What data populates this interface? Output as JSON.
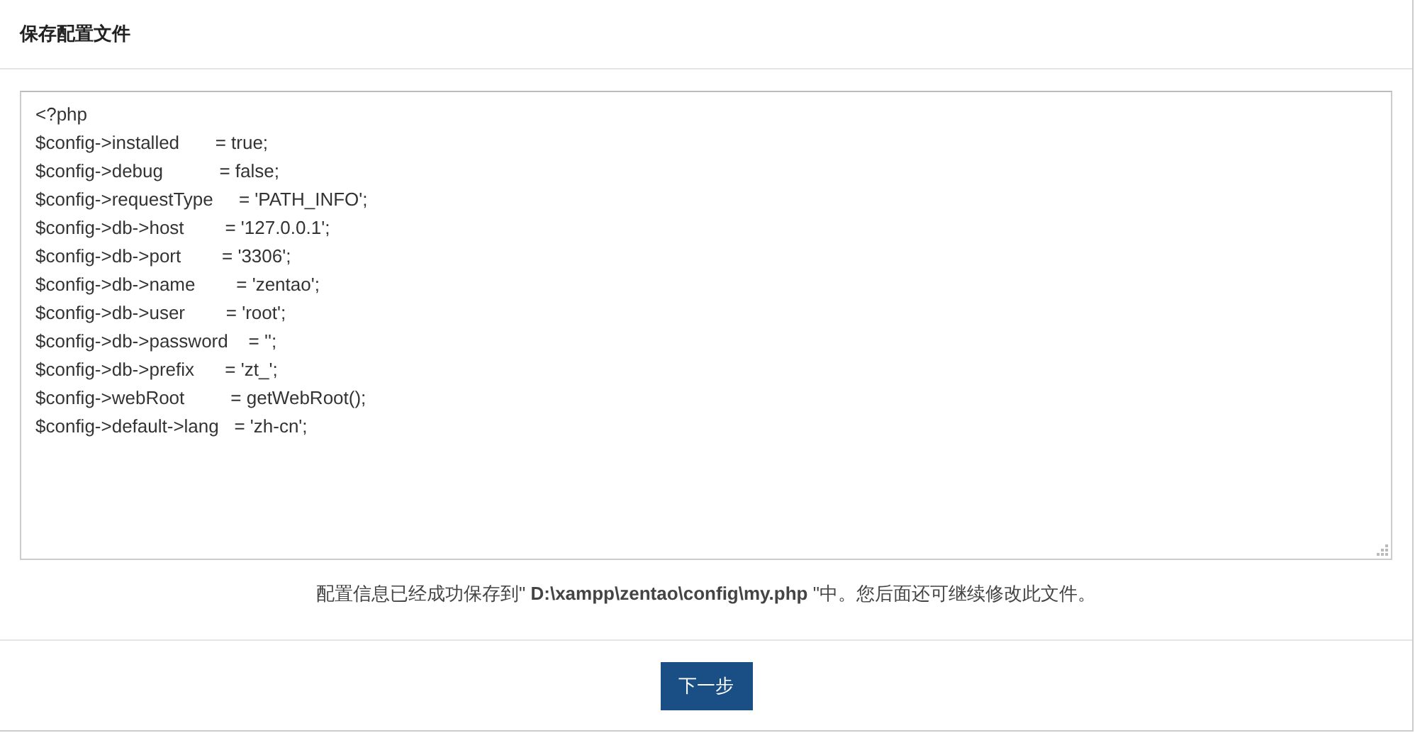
{
  "header": {
    "title": "保存配置文件"
  },
  "config_editor": {
    "lines": [
      "<?php",
      "$config->installed       = true;",
      "$config->debug           = false;",
      "$config->requestType     = 'PATH_INFO';",
      "$config->db->host        = '127.0.0.1';",
      "$config->db->port        = '3306';",
      "$config->db->name        = 'zentao';",
      "$config->db->user        = 'root';",
      "$config->db->password    = '';",
      "$config->db->prefix      = 'zt_';",
      "$config->webRoot         = getWebRoot();",
      "$config->default->lang   = 'zh-cn';"
    ]
  },
  "message": "配置信息已经成功保存到\" **D:\\xampp\\zentao\\config\\my.php** \"中。您后面还可继续修改此文件。",
  "buttons": [
    {
      "label": "下一步",
      "kind": "primary"
    }
  ]
}
